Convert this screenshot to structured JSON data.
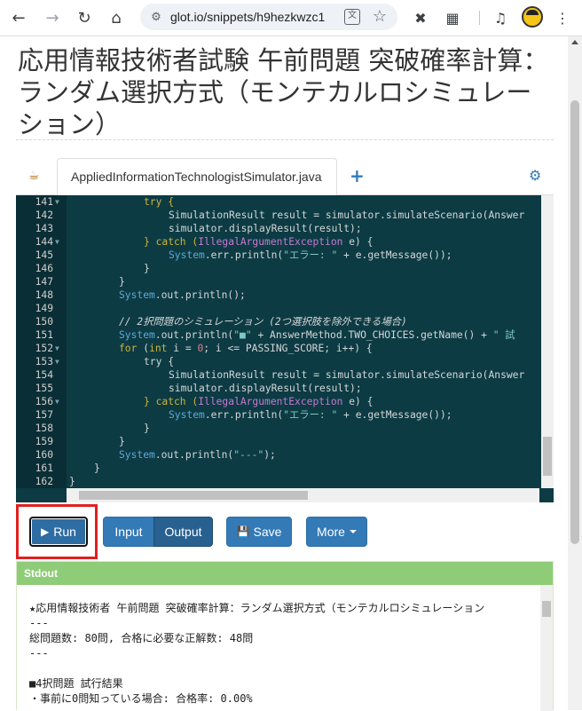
{
  "browser": {
    "url": "glot.io/snippets/h9hezkwzc1"
  },
  "page": {
    "title": "応用情報技術者試験 午前問題 突破確率計算：ランダム選択方式（モンテカルロシミュレーション）"
  },
  "tabs": {
    "active_file": "AppliedInformationTechnologistSimulator.java",
    "add_label": "+"
  },
  "editor": {
    "lines": [
      {
        "n": "141",
        "fold": true
      },
      {
        "n": "142",
        "fold": false
      },
      {
        "n": "143",
        "fold": false
      },
      {
        "n": "144",
        "fold": true
      },
      {
        "n": "145",
        "fold": false
      },
      {
        "n": "146",
        "fold": false
      },
      {
        "n": "147",
        "fold": false
      },
      {
        "n": "148",
        "fold": false
      },
      {
        "n": "149",
        "fold": false
      },
      {
        "n": "150",
        "fold": false
      },
      {
        "n": "151",
        "fold": false
      },
      {
        "n": "152",
        "fold": true
      },
      {
        "n": "153",
        "fold": true
      },
      {
        "n": "154",
        "fold": false
      },
      {
        "n": "155",
        "fold": false
      },
      {
        "n": "156",
        "fold": true
      },
      {
        "n": "157",
        "fold": false
      },
      {
        "n": "158",
        "fold": false
      },
      {
        "n": "159",
        "fold": false
      },
      {
        "n": "160",
        "fold": false
      },
      {
        "n": "161",
        "fold": false
      },
      {
        "n": "162",
        "fold": false
      }
    ],
    "code": {
      "l141": "try {",
      "l142a": "SimulationResult result = simulator.simulateScenario(Answer",
      "l143": "simulator.displayResult(result);",
      "l144a": "} catch (",
      "l144b": "IllegalArgumentException",
      "l144c": " e) {",
      "l145a": "System",
      "l145b": ".err.println(",
      "l145c": "\"エラー: \"",
      "l145d": " + e.getMessage());",
      "l146": "}",
      "l147": "}",
      "l148a": "System",
      "l148b": ".out.println();",
      "l149": "",
      "l150": "// 2択問題のシミュレーション (2つ選択肢を除外できる場合)",
      "l151a": "System",
      "l151b": ".out.println(",
      "l151c": "\"■\"",
      "l151d": " + AnswerMethod.TWO_CHOICES.getName() + ",
      "l151e": "\" 試",
      "l152a": "for",
      "l152b": " (",
      "l152c": "int",
      "l152d": " i = ",
      "l152e": "0",
      "l152f": "; i <= PASSING_SCORE; i++) {",
      "l153": "try {",
      "l154": "SimulationResult result = simulator.simulateScenario(Answer",
      "l155": "simulator.displayResult(result);",
      "l156a": "} catch (",
      "l156b": "IllegalArgumentException",
      "l156c": " e) {",
      "l157a": "System",
      "l157b": ".err.println(",
      "l157c": "\"エラー: \"",
      "l157d": " + e.getMessage());",
      "l158": "}",
      "l159": "}",
      "l160a": "System",
      "l160b": ".out.println(",
      "l160c": "\"---\"",
      "l160d": ");",
      "l161": "}",
      "l162": "}"
    }
  },
  "buttons": {
    "run": "Run",
    "input": "Input",
    "output": "Output",
    "save": "Save",
    "more": "More"
  },
  "stdout": {
    "header": "Stdout",
    "lines": [
      "★応用情報技術者 午前問題 突破確率計算：ランダム選択方式（モンテカルロシミュレーション",
      "---",
      "総問題数: 80問, 合格に必要な正解数: 48問",
      "---",
      "",
      "■4択問題 試行結果",
      "・事前に0問知っている場合: 合格率: 0.00%"
    ]
  }
}
